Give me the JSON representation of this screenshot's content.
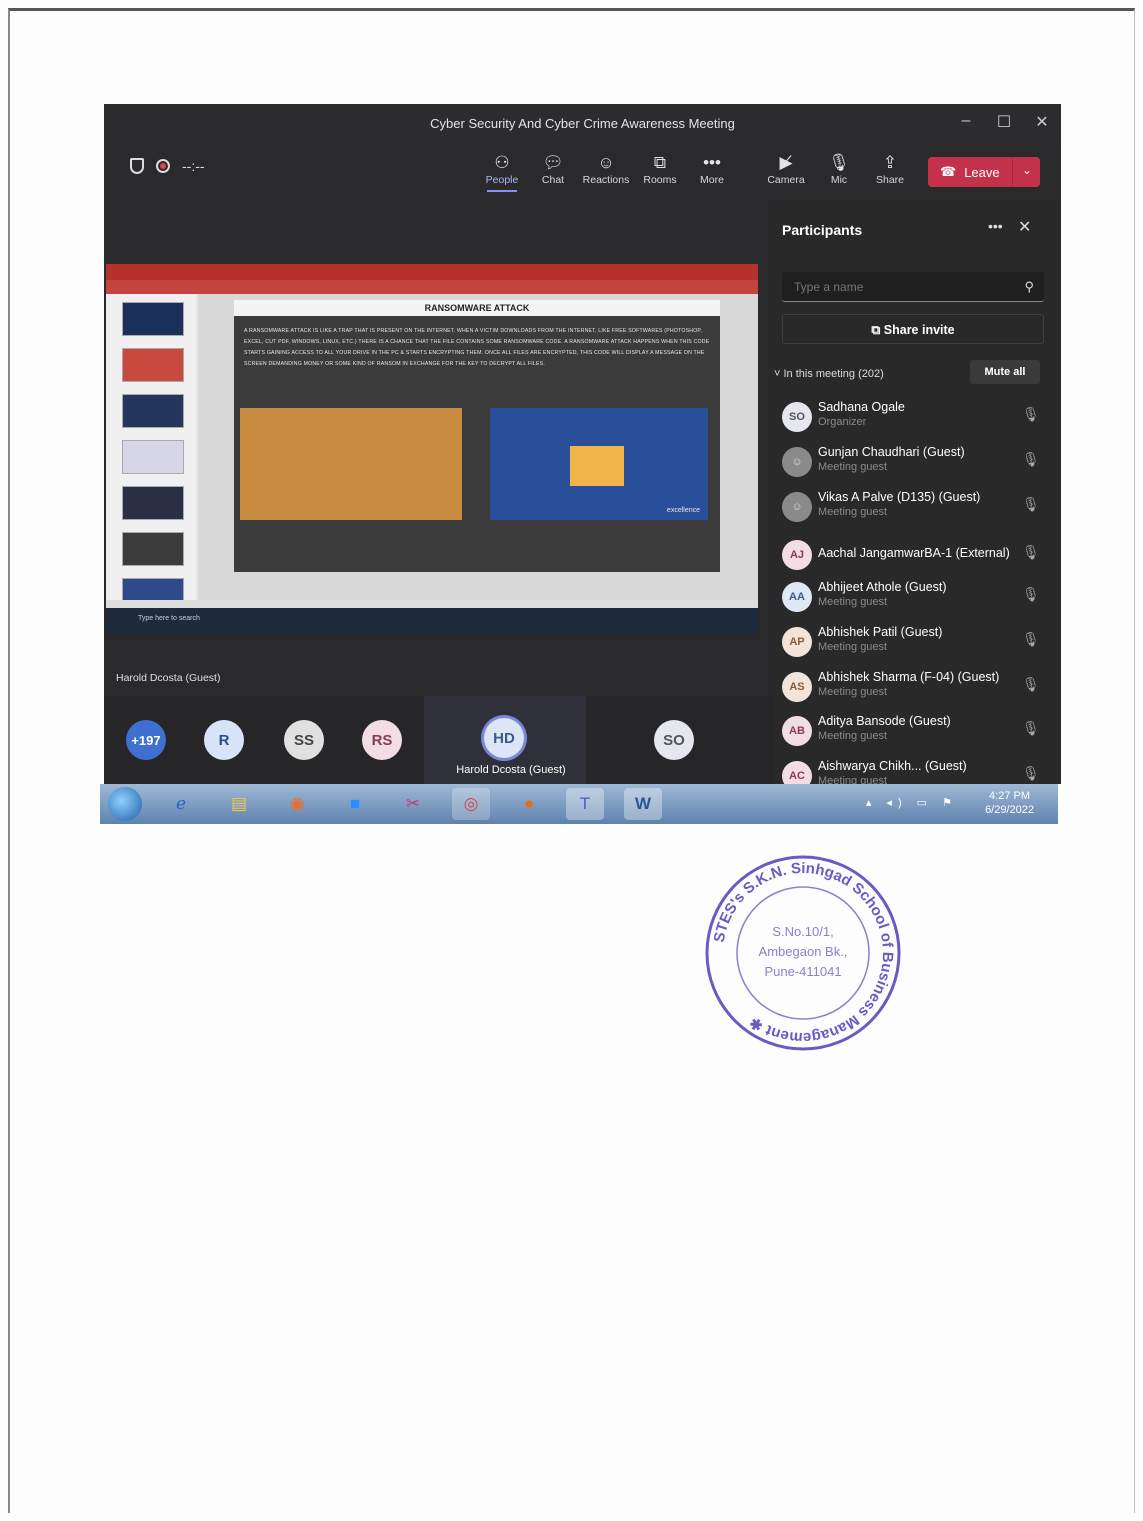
{
  "window": {
    "title": "Cyber Security And Cyber Crime Awareness Meeting",
    "controls": [
      "–",
      "☐",
      "✕"
    ]
  },
  "toolbar": {
    "timer": "--:--",
    "buttons": [
      {
        "label": "People",
        "icon": "people-icon",
        "active": true
      },
      {
        "label": "Chat",
        "icon": "chat-icon"
      },
      {
        "label": "Reactions",
        "icon": "reactions-icon"
      },
      {
        "label": "Rooms",
        "icon": "rooms-icon"
      },
      {
        "label": "More",
        "icon": "more-icon"
      },
      {
        "label": "Camera",
        "icon": "camera-off-icon"
      },
      {
        "label": "Mic",
        "icon": "mic-off-icon"
      },
      {
        "label": "Share",
        "icon": "share-icon"
      }
    ],
    "leave_label": "Leave"
  },
  "shared_screen": {
    "slide_title": "RANSOMWARE ATTACK",
    "slide_text": "A RANSOMWARE ATTACK IS LIKE A TRAP THAT IS PRESENT ON THE INTERNET. WHEN A VICTIM DOWNLOADS FROM THE INTERNET, LIKE FREE SOFTWARES (PHOTOSHOP, EXCEL, CUT PDF, WINDOWS, LINUX, ETC.) THERE IS A CHANCE THAT THE FILE CONTAINS SOME RANSOMWARE CODE. A RANSOMWARE ATTACK HAPPENS WHEN THIS CODE STARTS GAINING ACCESS TO ALL YOUR DRIVE IN THE PC & STARTS ENCRYPTING THEM. ONCE ALL FILES ARE ENCRYPTED, THIS CODE WILL DISPLAY A MESSAGE ON THE SCREEN DEMANDING MONEY OR SOME KIND OF RANSOM IN EXCHANGE FOR THE KEY TO DECRYPT ALL FILES.",
    "image_caption": "excellence",
    "search_placeholder": "Type here to search",
    "sharer": "Harold Dcosta (Guest)"
  },
  "strip": {
    "avatars": [
      {
        "initials": "+197",
        "color": "#3f6fd1"
      },
      {
        "initials": "R",
        "color": "#d7e3f7"
      },
      {
        "initials": "SS",
        "color": "#e0e0e0"
      },
      {
        "initials": "RS",
        "color": "#f3dde4"
      },
      {
        "initials": "SO",
        "color": "#e6e6ee"
      }
    ],
    "focused": {
      "initials": "HD",
      "name": "Harold Dcosta (Guest)"
    }
  },
  "participants": {
    "title": "Participants",
    "search_placeholder": "Type a name",
    "share_invite": "Share invite",
    "in_meeting": "In this meeting (202)",
    "mute_all": "Mute all",
    "list": [
      {
        "initials": "SO",
        "name": "Sadhana Ogale",
        "role": "Organizer",
        "color": "#e6e6ee"
      },
      {
        "initials": "",
        "name": "Gunjan Chaudhari (Guest)",
        "role": "Meeting guest",
        "color": "#8a8a8a"
      },
      {
        "initials": "",
        "name": "Vikas A Palve (D135) (Guest)",
        "role": "Meeting guest",
        "color": "#8a8a8a"
      },
      {
        "initials": "AJ",
        "name": "Aachal JangamwarBA-1 (External)",
        "role": "",
        "color": "#f3dde4"
      },
      {
        "initials": "AA",
        "name": "Abhijeet Athole (Guest)",
        "role": "Meeting guest",
        "color": "#dfe8f5"
      },
      {
        "initials": "AP",
        "name": "Abhishek Patil (Guest)",
        "role": "Meeting guest",
        "color": "#f2e4d8"
      },
      {
        "initials": "AS",
        "name": "Abhishek Sharma (F-04) (Guest)",
        "role": "Meeting guest",
        "color": "#f2e4d8"
      },
      {
        "initials": "AB",
        "name": "Aditya Bansode (Guest)",
        "role": "Meeting guest",
        "color": "#f3dde4"
      },
      {
        "initials": "AC",
        "name": "Aishwarya Chikh... (Guest)",
        "role": "Meeting guest",
        "color": "#f3dde4"
      }
    ]
  },
  "taskbar": {
    "time": "4:27 PM",
    "date": "6/29/2022"
  },
  "stamp": {
    "outer_text": "STES's S.K.N. Sinhgad School of Business Management",
    "line1": "S.No.10/1,",
    "line2": "Ambegaon Bk.,",
    "line3": "Pune-411041"
  }
}
